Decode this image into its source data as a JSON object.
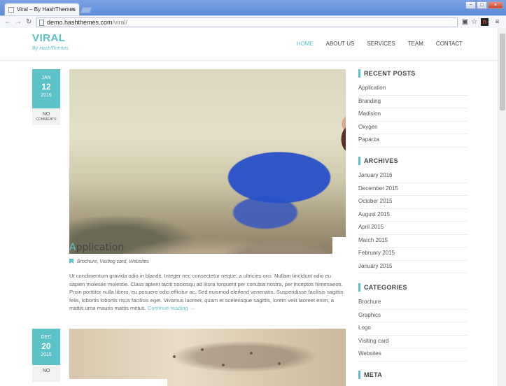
{
  "browser": {
    "tab_title": "Viral – By HashThemes",
    "tab_close": "×",
    "url_host": "demo.hashthemes.com",
    "url_path": "/viral/",
    "window_buttons": [
      "−",
      "□",
      "×"
    ],
    "nav_icons": [
      "back-icon",
      "forward-icon",
      "reload-icon"
    ],
    "toolbar_icons": [
      "translate-icon",
      "star-icon",
      "extension-icon",
      "menu-icon"
    ]
  },
  "site": {
    "logo": "VIRAL",
    "tagline": "By HashThemes",
    "accent": "#5bc2c7",
    "nav": [
      "HOME",
      "ABOUT US",
      "SERVICES",
      "TEAM",
      "CONTACT"
    ]
  },
  "posts": [
    {
      "month": "JAN",
      "day": "12",
      "year": "2016",
      "comments_count": "NO",
      "comments_label": "COMMENTS",
      "title_first": "A",
      "title_rest": "pplication",
      "categories": "Brochure, Visiting card, Websites",
      "excerpt": "Ut condimentum gravida odio in blandit. Integer nec consectetur neque, a ultricies orci. Nullam tincidunt odio eu sapien molestie molestie. Class aptent taciti sociosqu ad litora torquent per conubia nostra, per inceptos himenaeos. Proin porttitor nulla libero, eu posuere odio efficitur ac. Sed euismod eleifend venenatis. Suspendisse facilisis sagittis felis, lobortis lobortis risus facilisis eget. Vivamus laoreet, quam et scelerisque sagittis, lorem velit laoreet enim, a mattis urna mauris mattis metus.",
      "read_more": "Continue reading →"
    },
    {
      "month": "DEC",
      "day": "20",
      "year": "2015",
      "comments_count": "NO"
    }
  ],
  "sidebar": {
    "recent_posts": {
      "title": "RECENT POSTS",
      "items": [
        "Application",
        "Branding",
        "Madision",
        "Oxygen",
        "Paparza"
      ]
    },
    "archives": {
      "title": "ARCHIVES",
      "items": [
        "January 2016",
        "December 2015",
        "October 2015",
        "August 2015",
        "April 2015",
        "March 2015",
        "February 2015",
        "January 2015"
      ]
    },
    "categories": {
      "title": "CATEGORIES",
      "items": [
        "Brochure",
        "Graphics",
        "Logo",
        "Visiting card",
        "Websites"
      ]
    },
    "meta": {
      "title": "META"
    }
  }
}
